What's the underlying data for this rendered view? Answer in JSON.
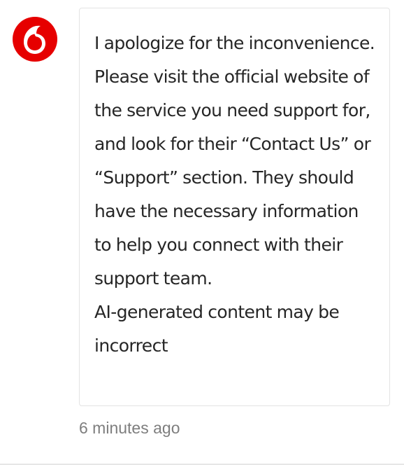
{
  "message": {
    "sender_icon": "vodafone-logo-icon",
    "brand_color": "#e60000",
    "body": "I apologize for the inconvenience. Please visit the official website of the service you need support for, and look for their “Contact Us” or “Support” section. They should have the necessary information to help you connect with their support team.",
    "disclaimer": "AI-generated content may be incorrect",
    "timestamp": "6 minutes ago"
  }
}
